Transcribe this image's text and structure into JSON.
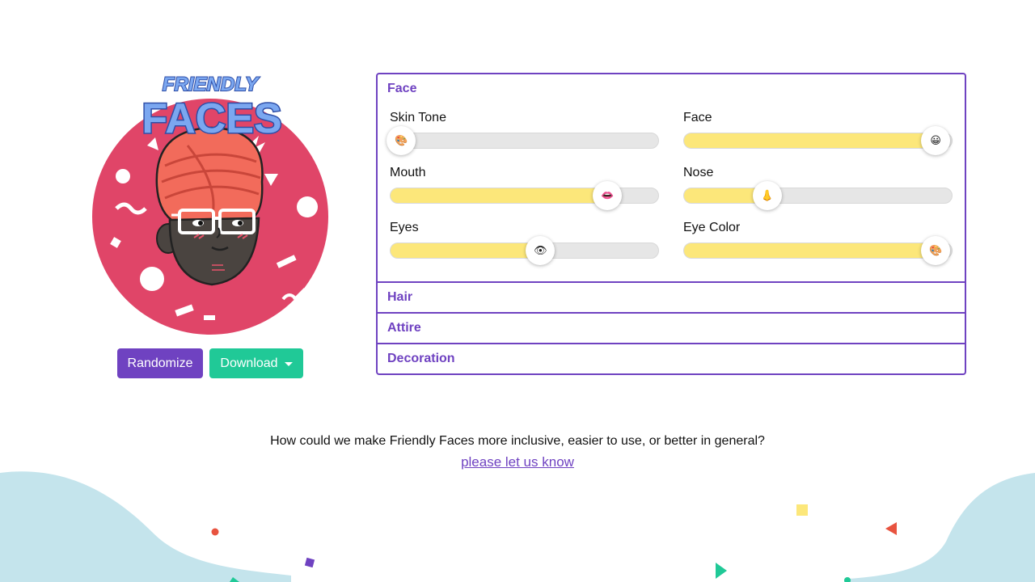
{
  "logo": {
    "line1": "FRIENDLY",
    "line2": "FACES"
  },
  "buttons": {
    "randomize": "Randomize",
    "download": "Download"
  },
  "sections": [
    {
      "title": "Face",
      "expanded": true
    },
    {
      "title": "Hair",
      "expanded": false
    },
    {
      "title": "Attire",
      "expanded": false
    },
    {
      "title": "Decoration",
      "expanded": false
    }
  ],
  "face_sliders": [
    {
      "label": "Skin Tone",
      "value_fraction": 0.04,
      "icon": "palette-icon",
      "glyph": "🎨"
    },
    {
      "label": "Face",
      "value_fraction": 0.94,
      "icon": "smiley-icon",
      "glyph": "😀"
    },
    {
      "label": "Mouth",
      "value_fraction": 0.81,
      "icon": "lips-icon",
      "glyph": "👄"
    },
    {
      "label": "Nose",
      "value_fraction": 0.31,
      "icon": "nose-icon",
      "glyph": "👃"
    },
    {
      "label": "Eyes",
      "value_fraction": 0.56,
      "icon": "eye-icon",
      "glyph": "👁"
    },
    {
      "label": "Eye Color",
      "value_fraction": 0.94,
      "icon": "palette-icon",
      "glyph": "🎨"
    }
  ],
  "feedback": {
    "question": "How could we make Friendly Faces more inclusive, easier to use, or better in general?",
    "link": "please let us know"
  },
  "colors": {
    "accent": "#6f42c1",
    "download": "#20c997",
    "slider_fill": "#fce77a",
    "avatar_bg": "#e04568",
    "turban": "#f26b5b",
    "wave": "#c4e4ec"
  }
}
